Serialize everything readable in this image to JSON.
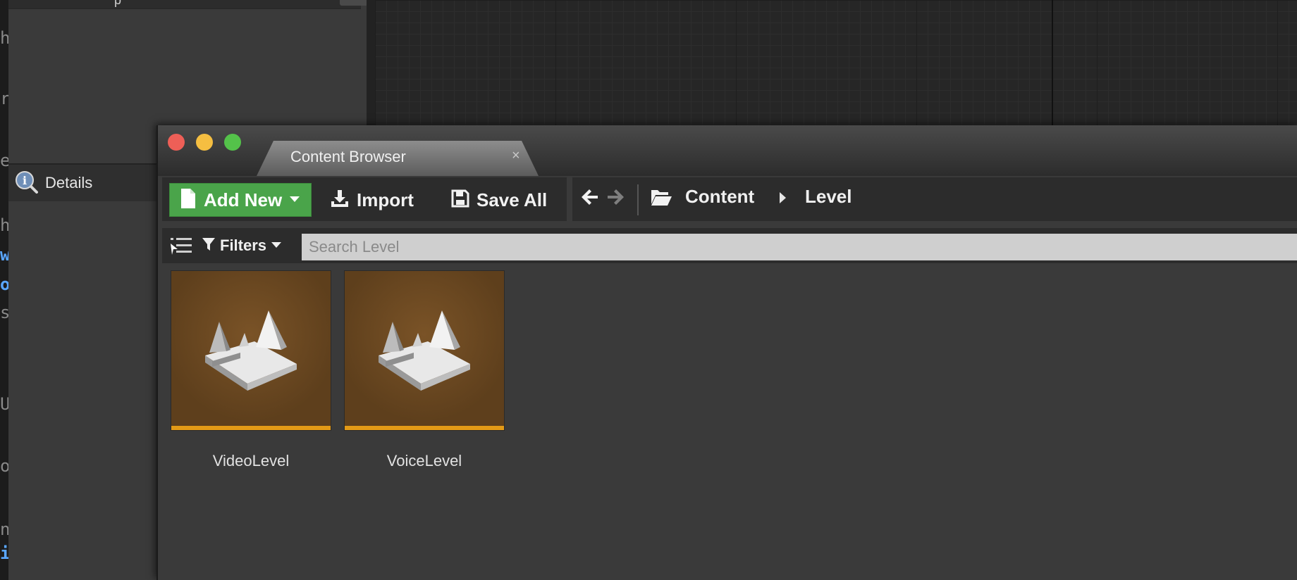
{
  "window": {
    "tab_title": "Content Browser",
    "tab_close": "×"
  },
  "toolbar": {
    "add_new_label": "Add New",
    "import_label": "Import",
    "save_all_label": "Save All"
  },
  "breadcrumb": {
    "items": [
      "Content",
      "Level"
    ]
  },
  "filter_bar": {
    "filters_label": "Filters",
    "search_placeholder": "Search Level"
  },
  "assets": [
    {
      "name": "VideoLevel"
    },
    {
      "name": "VoiceLevel"
    }
  ],
  "details_panel": {
    "tab_label": "Details"
  },
  "colors": {
    "add_new_green": "#4aa44a",
    "asset_underline": "#e39a16",
    "thumbnail_brown": "#6a4520"
  },
  "background_code_glyphs": [
    "h",
    "r",
    "e",
    "h",
    "w",
    "o",
    "s",
    "U",
    "o",
    "n",
    "i"
  ]
}
